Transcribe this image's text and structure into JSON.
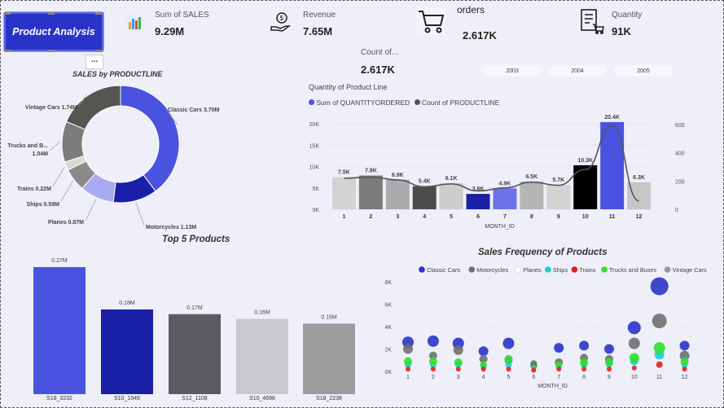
{
  "button": {
    "label": "Product Analysis"
  },
  "more_label": "...",
  "kpis": {
    "sales": {
      "label": "Sum of SALES",
      "value": "9.29M"
    },
    "revenue": {
      "label": "Revenue",
      "value": "7.65M"
    },
    "orders": {
      "label": "orders",
      "value": "2.617K"
    },
    "quantity": {
      "label": "Quantity",
      "value": "91K"
    },
    "count": {
      "label": "Count of...",
      "value": "2.617K"
    }
  },
  "years": [
    "2003",
    "2004",
    "2005"
  ],
  "colors": {
    "accent": "#2a33c9",
    "bg": "#eeeff8"
  },
  "icons": {
    "sales": "chart-icon",
    "revenue": "money-hand-icon",
    "orders": "cart-icon",
    "quantity": "invoice-cart-icon"
  },
  "chart_data": [
    {
      "type": "pie",
      "title": "SALES by PRODUCTLINE",
      "categories": [
        "Classic Cars",
        "Motorcycles",
        "Planes",
        "Ships",
        "Trains",
        "Trucks and B...",
        "Vintage Cars"
      ],
      "values": [
        3.7,
        1.13,
        0.87,
        0.59,
        0.22,
        1.04,
        1.74
      ],
      "labels": [
        "Classic Cars 3.70M",
        "Motorcycles 1.13M",
        "Planes 0.87M",
        "Ships 0.59M",
        "Trains 0.22M",
        "Trucks and B... 1.04M",
        "Vintage Cars 1.74M"
      ],
      "colors": [
        "#4a52e0",
        "#1a20a8",
        "#a9abf0",
        "#8a8a8a",
        "#d8dccf",
        "#7c7c7c",
        "#575552"
      ]
    },
    {
      "type": "bar",
      "title": "Quantity of Product Line",
      "series": [
        {
          "name": "Sum of QUANTITYORDERED",
          "values": [
            7.5,
            7.9,
            6.9,
            5.4,
            6.1,
            3.6,
            4.9,
            6.5,
            5.7,
            10.3,
            20.4,
            6.3
          ]
        },
        {
          "name": "Count of PRODUCTLINE",
          "values": [
            220,
            228,
            208,
            160,
            180,
            130,
            152,
            192,
            170,
            282,
            592,
            60
          ]
        }
      ],
      "categories": [
        "1",
        "2",
        "3",
        "4",
        "5",
        "6",
        "7",
        "8",
        "9",
        "10",
        "11",
        "12"
      ],
      "data_labels": [
        "7.5K",
        "7.9K",
        "6.9K",
        "5.4K",
        "6.1K",
        "3.6K",
        "4.9K",
        "6.5K",
        "5.7K",
        "10.3K",
        "20.4K",
        "6.3K"
      ],
      "bar_colors": [
        "#d3d3d3",
        "#7b7b7b",
        "#aaaaaa",
        "#4c4c4c",
        "#cccccc",
        "#1a20a8",
        "#6b72ea",
        "#b5b5b5",
        "#d3d3d3",
        "#000000",
        "#4a52e0",
        "#c6c6c6"
      ],
      "xlabel": "MONTH_ID",
      "ylim": [
        0,
        22
      ],
      "y_ticks": [
        "0K",
        "5K",
        "10K",
        "15K",
        "20K"
      ],
      "y2lim": [
        0,
        640
      ],
      "y2_ticks": [
        "0",
        "200",
        "400",
        "600"
      ]
    },
    {
      "type": "bar",
      "title": "Top 5 Products",
      "categories": [
        "S18_3232",
        "S10_1949",
        "S12_1108",
        "S10_4698",
        "S18_2238"
      ],
      "values": [
        0.27,
        0.18,
        0.17,
        0.16,
        0.15
      ],
      "labels": [
        "0.27M",
        "0.18M",
        "0.17M",
        "0.16M",
        "0.15M"
      ],
      "colors": [
        "#4a52e0",
        "#1a20a8",
        "#5a5c60",
        "#c8c9cd",
        "#9c9c9c"
      ],
      "ylim": [
        0,
        0.29
      ]
    },
    {
      "type": "scatter",
      "title": "Sales Frequency of Products",
      "xlabel": "MONTH_ID",
      "x": [
        1,
        2,
        3,
        4,
        5,
        6,
        7,
        8,
        9,
        10,
        11,
        12
      ],
      "ylim": [
        0,
        8
      ],
      "y_ticks": [
        "0K",
        "2K",
        "4K",
        "6K",
        "8K"
      ],
      "series": [
        {
          "name": "Classic Cars",
          "color": "#2a33c9",
          "values": [
            2.6,
            2.7,
            2.5,
            1.8,
            2.5,
            0.5,
            2.1,
            2.3,
            2.0,
            3.9,
            7.6,
            2.3
          ],
          "sizes": [
            7,
            7,
            7,
            6,
            7,
            4,
            6,
            6,
            6,
            8,
            11,
            6
          ]
        },
        {
          "name": "Motorcycles",
          "color": "#6f6f6f",
          "values": [
            2.0,
            1.4,
            1.9,
            1.1,
            1.0,
            0.7,
            0.8,
            1.2,
            1.1,
            2.5,
            4.5,
            1.4
          ],
          "sizes": [
            6,
            5,
            6,
            5,
            5,
            4,
            5,
            5,
            5,
            7,
            9,
            6
          ]
        },
        {
          "name": "Planes",
          "color": "#ffffff",
          "values": [],
          "sizes": []
        },
        {
          "name": "Ships",
          "color": "#19d1cf",
          "values": [
            0.6,
            0.6,
            0.6,
            0.5,
            0.6,
            0.3,
            0.5,
            0.6,
            0.6,
            0.9,
            1.5,
            0.6
          ],
          "sizes": [
            4,
            4,
            4,
            4,
            4,
            3,
            4,
            4,
            4,
            5,
            6,
            4
          ]
        },
        {
          "name": "Trains",
          "color": "#e02020",
          "values": [
            0.2,
            0.2,
            0.2,
            0.2,
            0.2,
            0.1,
            0.2,
            0.2,
            0.2,
            0.3,
            0.6,
            0.2
          ],
          "sizes": [
            3,
            3,
            3,
            3,
            3,
            3,
            3,
            3,
            3,
            3,
            4,
            3
          ]
        },
        {
          "name": "Trucks and Buses",
          "color": "#2ee02e",
          "values": [
            0.9,
            0.9,
            0.8,
            0.6,
            1.1,
            0.4,
            0.6,
            0.8,
            0.8,
            1.2,
            2.1,
            0.9
          ],
          "sizes": [
            5,
            5,
            5,
            4,
            5,
            3,
            4,
            5,
            5,
            6,
            7,
            5
          ]
        },
        {
          "name": "Vintage Cars",
          "color": "#999999",
          "values": [],
          "sizes": []
        }
      ]
    }
  ]
}
